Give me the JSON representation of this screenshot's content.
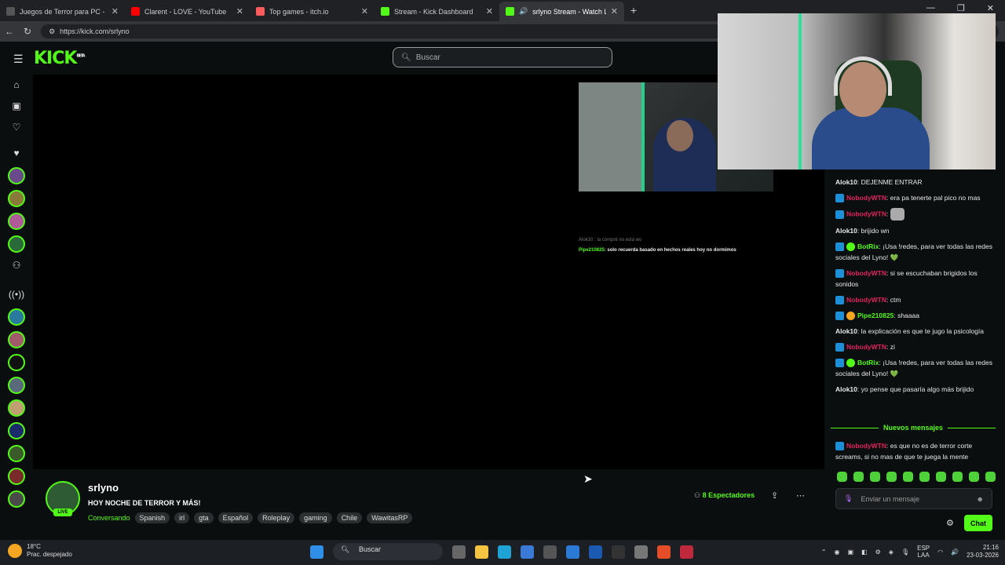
{
  "browser": {
    "tabs": [
      {
        "title": "Juegos de Terror para PC - Página",
        "color": "#555"
      },
      {
        "title": "Clarent - LOVE - YouTube",
        "color": "#ff0000"
      },
      {
        "title": "Top games - itch.io",
        "color": "#fa5c5c"
      },
      {
        "title": "Stream - Kick Dashboard",
        "color": "#53fc18"
      },
      {
        "title": "srlyno Stream - Watch Live on",
        "color": "#53fc18",
        "active": true
      }
    ],
    "url": "https://kick.com/srlyno"
  },
  "kick": {
    "logo": "KICK",
    "logo_sup": "BETA",
    "search_placeholder": "Buscar"
  },
  "overlay": {
    "faded_line": "Alok10 : la compré no está ws",
    "user": "Pipe210825",
    "text": ": solo recuerda basado en hechos reales hoy no dormimos"
  },
  "chat": {
    "messages": [
      {
        "user": "Alok10",
        "text": "DEJENME ENTRAR",
        "color": "#ffffff",
        "badge": ""
      },
      {
        "user": "NobodyWTN",
        "text": "era pa tenerte pal pico no mas",
        "color": "#e0245e",
        "badge": "blue"
      },
      {
        "user": "NobodyWTN",
        "text": "",
        "color": "#e0245e",
        "badge": "blue",
        "emote": true
      },
      {
        "user": "Alok10",
        "text": "brijido wn",
        "color": "#ffffff",
        "badge": ""
      },
      {
        "user": "BotRix",
        "text": "¡Usa !redes, para ver todas las redes sociales del Lyno! 💚",
        "color": "#53fc18",
        "badge": "bot"
      },
      {
        "user": "NobodyWTN",
        "text": "si se escuchaban brigidos los sonidos",
        "color": "#e0245e",
        "badge": "blue"
      },
      {
        "user": "NobodyWTN",
        "text": "ctm",
        "color": "#e0245e",
        "badge": "blue"
      },
      {
        "user": "Pipe210825",
        "text": "shaaaa",
        "color": "#53fc18",
        "badge": "orange"
      },
      {
        "user": "Alok10",
        "text": "la explicación es que te jugo la psicología",
        "color": "#ffffff",
        "badge": ""
      },
      {
        "user": "NobodyWTN",
        "text": "zi",
        "color": "#e0245e",
        "badge": "blue"
      },
      {
        "user": "BotRix",
        "text": "¡Usa !redes, para ver todas las redes sociales del Lyno! 💚",
        "color": "#53fc18",
        "badge": "bot"
      },
      {
        "user": "Alok10",
        "text": "yo pense que pasaría algo más brijido",
        "color": "#ffffff",
        "badge": ""
      }
    ],
    "new_messages_label": "Nuevos mensajes",
    "after_new": {
      "user": "NobodyWTN",
      "text": "es que no es de terror corte screams, si no mas de que te juega la mente",
      "color": "#e0245e"
    },
    "input_placeholder": "Enviar un mensaje",
    "send_label": "Chat"
  },
  "stream": {
    "streamer": "srlyno",
    "live": "LIVE",
    "title": "HOY NOCHE DE TERROR Y MÁS!",
    "category": "Conversando",
    "tags": [
      "Spanish",
      "irl",
      "gta",
      "Español",
      "Roleplay",
      "gaming",
      "Chile",
      "WawitasRP"
    ],
    "viewers_count": "8",
    "viewers_label": "Espectadores"
  },
  "taskbar": {
    "temp": "18°C",
    "weather": "Prac. despejado",
    "search": "Buscar",
    "lang1": "ESP",
    "lang2": "LAA",
    "time": "21:16",
    "date": "23-03-2026"
  }
}
